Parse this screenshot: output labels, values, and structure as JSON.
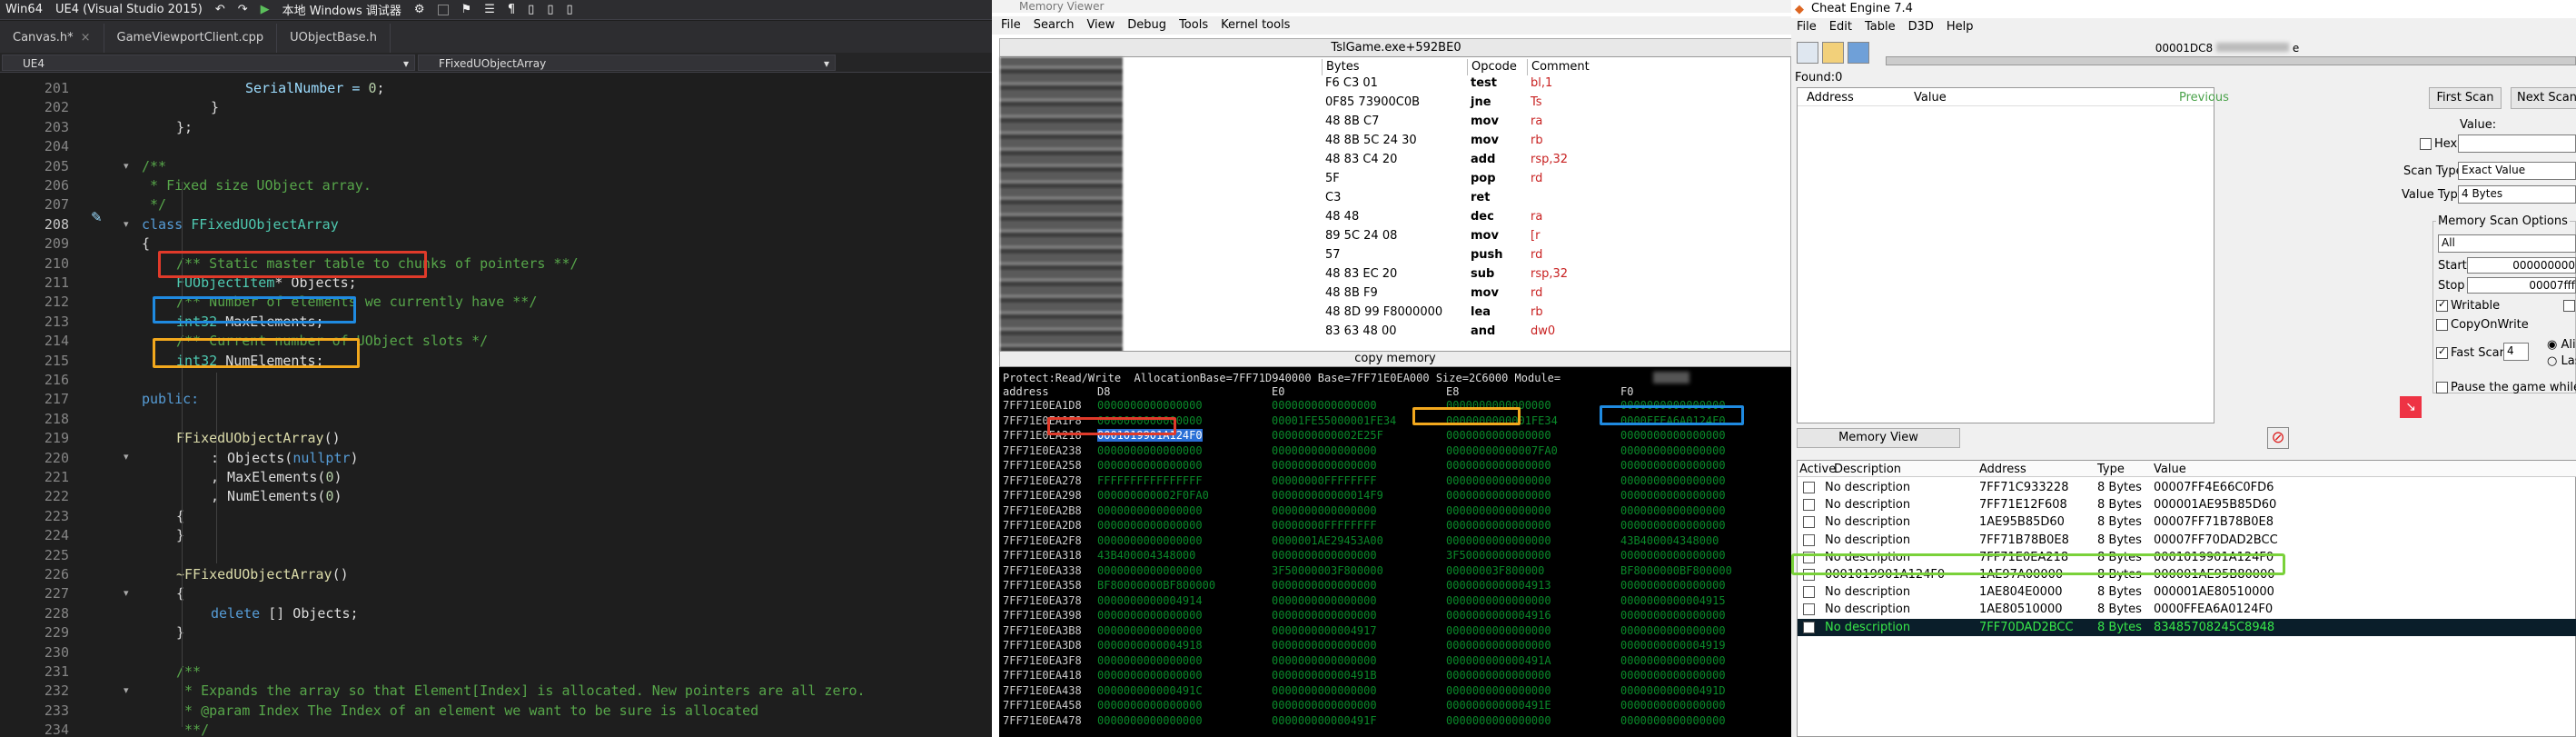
{
  "vs": {
    "config": "Win64",
    "project": "UE4 (Visual Studio 2015)",
    "debugger": "本地 Windows 调试器",
    "tabs": [
      {
        "label": "Canvas.h*"
      },
      {
        "label": "GameViewportClient.cpp"
      },
      {
        "label": "UObjectBase.h"
      }
    ],
    "nav_left": "UE4",
    "nav_right": "FFixedUObjectArray",
    "lines": [
      {
        "num": "201",
        "indent": 3,
        "parts": [
          {
            "t": "SerialNumber = ",
            "c": "var"
          },
          {
            "t": "0",
            "c": "num"
          },
          {
            "t": ";",
            "c": ""
          }
        ]
      },
      {
        "num": "202",
        "indent": 2,
        "parts": [
          {
            "t": "}",
            "c": ""
          }
        ]
      },
      {
        "num": "203",
        "indent": 1,
        "parts": [
          {
            "t": "};",
            "c": ""
          }
        ]
      },
      {
        "num": "204",
        "indent": 0,
        "parts": []
      },
      {
        "num": "205",
        "indent": 0,
        "parts": [
          {
            "t": "/**",
            "c": "com"
          }
        ]
      },
      {
        "num": "206",
        "indent": 0,
        "parts": [
          {
            "t": " * Fixed size UObject array.",
            "c": "com"
          }
        ]
      },
      {
        "num": "207",
        "indent": 0,
        "parts": [
          {
            "t": " */",
            "c": "com"
          }
        ]
      },
      {
        "num": "208",
        "indent": 0,
        "parts": [
          {
            "t": "class ",
            "c": "kw"
          },
          {
            "t": "FFixedUObjectArray",
            "c": "type"
          }
        ]
      },
      {
        "num": "209",
        "indent": 0,
        "parts": [
          {
            "t": "{",
            "c": ""
          }
        ]
      },
      {
        "num": "210",
        "indent": 1,
        "parts": [
          {
            "t": "/** Static master table to chunks of pointers **/",
            "c": "com"
          }
        ]
      },
      {
        "num": "211",
        "indent": 1,
        "parts": [
          {
            "t": "FUObjectItem",
            "c": "type"
          },
          {
            "t": "* Objects;",
            "c": ""
          }
        ]
      },
      {
        "num": "212",
        "indent": 1,
        "parts": [
          {
            "t": "/** Number of elements we currently have **/",
            "c": "com"
          }
        ]
      },
      {
        "num": "213",
        "indent": 1,
        "parts": [
          {
            "t": "int32 ",
            "c": "type"
          },
          {
            "t": "MaxElements;",
            "c": ""
          }
        ]
      },
      {
        "num": "214",
        "indent": 1,
        "parts": [
          {
            "t": "/** Current number of UObject slots */",
            "c": "com"
          }
        ]
      },
      {
        "num": "215",
        "indent": 1,
        "parts": [
          {
            "t": "int32 ",
            "c": "type"
          },
          {
            "t": "NumElements;",
            "c": ""
          }
        ]
      },
      {
        "num": "216",
        "indent": 0,
        "parts": []
      },
      {
        "num": "217",
        "indent": 0,
        "parts": [
          {
            "t": "public:",
            "c": "kw"
          }
        ]
      },
      {
        "num": "218",
        "indent": 0,
        "parts": []
      },
      {
        "num": "219",
        "indent": 1,
        "parts": [
          {
            "t": "FFixedUObjectArray",
            "c": "fn"
          },
          {
            "t": "()",
            "c": ""
          }
        ]
      },
      {
        "num": "220",
        "indent": 2,
        "parts": [
          {
            "t": ": Objects(",
            "c": ""
          },
          {
            "t": "nullptr",
            "c": "kw"
          },
          {
            "t": ")",
            "c": ""
          }
        ]
      },
      {
        "num": "221",
        "indent": 2,
        "parts": [
          {
            "t": ", MaxElements(",
            "c": ""
          },
          {
            "t": "0",
            "c": "num"
          },
          {
            "t": ")",
            "c": ""
          }
        ]
      },
      {
        "num": "222",
        "indent": 2,
        "parts": [
          {
            "t": ", NumElements(",
            "c": ""
          },
          {
            "t": "0",
            "c": "num"
          },
          {
            "t": ")",
            "c": ""
          }
        ]
      },
      {
        "num": "223",
        "indent": 1,
        "parts": [
          {
            "t": "{",
            "c": ""
          }
        ]
      },
      {
        "num": "224",
        "indent": 1,
        "parts": [
          {
            "t": "}",
            "c": ""
          }
        ]
      },
      {
        "num": "225",
        "indent": 0,
        "parts": []
      },
      {
        "num": "226",
        "indent": 1,
        "parts": [
          {
            "t": "~FFixedUObjectArray",
            "c": "fn"
          },
          {
            "t": "()",
            "c": ""
          }
        ]
      },
      {
        "num": "227",
        "indent": 1,
        "parts": [
          {
            "t": "{",
            "c": ""
          }
        ]
      },
      {
        "num": "228",
        "indent": 2,
        "parts": [
          {
            "t": "delete ",
            "c": "kw"
          },
          {
            "t": "[] Objects;",
            "c": ""
          }
        ]
      },
      {
        "num": "229",
        "indent": 1,
        "parts": [
          {
            "t": "}",
            "c": ""
          }
        ]
      },
      {
        "num": "230",
        "indent": 0,
        "parts": []
      },
      {
        "num": "231",
        "indent": 1,
        "parts": [
          {
            "t": "/**",
            "c": "com"
          }
        ]
      },
      {
        "num": "232",
        "indent": 1,
        "parts": [
          {
            "t": " * Expands the array so that Element[Index] is allocated. New pointers are all zero.",
            "c": "com"
          }
        ]
      },
      {
        "num": "233",
        "indent": 1,
        "parts": [
          {
            "t": " * @param Index The Index of an element we want to be sure is allocated",
            "c": "com"
          }
        ]
      },
      {
        "num": "234",
        "indent": 1,
        "parts": [
          {
            "t": " **/",
            "c": "com"
          }
        ]
      }
    ]
  },
  "memview": {
    "title": "Memory Viewer",
    "menu": [
      "File",
      "Search",
      "View",
      "Debug",
      "Tools",
      "Kernel tools"
    ],
    "disasm_title": "TslGame.exe+592BE0",
    "headers": [
      "Bytes",
      "Opcode",
      "Comment"
    ],
    "rows": [
      {
        "bytes": "F6 C3 01",
        "op": "test",
        "arg": "bl,1"
      },
      {
        "bytes": "0F85 73900C0B",
        "op": "jne",
        "arg": "Ts"
      },
      {
        "bytes": "48 8B C7",
        "op": "mov",
        "arg": "ra"
      },
      {
        "bytes": "48 8B 5C 24 30",
        "op": "mov",
        "arg": "rb"
      },
      {
        "bytes": "48 83 C4 20",
        "op": "add",
        "arg": "rsp,32"
      },
      {
        "bytes": "5F",
        "op": "pop",
        "arg": "rd"
      },
      {
        "bytes": "C3",
        "op": "ret",
        "arg": ""
      },
      {
        "bytes": "48 48",
        "op": "dec",
        "arg": "ra"
      },
      {
        "bytes": "89 5C 24 08",
        "op": "mov",
        "arg": "[r"
      },
      {
        "bytes": "57",
        "op": "push",
        "arg": "rd"
      },
      {
        "bytes": "48 83 EC 20",
        "op": "sub",
        "arg": "rsp,32"
      },
      {
        "bytes": "48 8B F9",
        "op": "mov",
        "arg": "rd"
      },
      {
        "bytes": "48 8D 99 F8000000",
        "op": "lea",
        "arg": "rb"
      },
      {
        "bytes": "83 63 48 00",
        "op": "and",
        "arg": "dw0"
      }
    ],
    "copy_label": "copy memory",
    "protect_line": "Protect:Read/Write  AllocationBase=7FF71D940000 Base=7FF71E0EA000 Size=2C6000 Module=",
    "col_headers": [
      "address",
      "D8",
      "E0",
      "E8",
      "F0"
    ],
    "hex_rows": [
      {
        "addr": "7FF71E0EA1D8",
        "v": [
          "0000000000000000",
          "0000000000000000",
          "0000000000000000",
          "0000000000000000"
        ]
      },
      {
        "addr": "7FF71E0EA1F8",
        "v": [
          "0000000000000000",
          "00001FE55000001FE34",
          "0000000000001FE34",
          "0000FFEA6A0124F0"
        ]
      },
      {
        "addr": "7FF71E0EA218",
        "v": [
          "0001019901A124F0",
          "0000000000002E25F",
          "0000000000000000",
          "0000000000000000"
        ]
      },
      {
        "addr": "7FF71E0EA238",
        "v": [
          "0000000000000000",
          "0000000000000000",
          "00000000000007FA0",
          "0000000000000000"
        ]
      },
      {
        "addr": "7FF71E0EA258",
        "v": [
          "0000000000000000",
          "0000000000000000",
          "0000000000000000",
          "0000000000000000"
        ]
      },
      {
        "addr": "7FF71E0EA278",
        "v": [
          "FFFFFFFFFFFFFFFF",
          "00000000FFFFFFFF",
          "0000000000000000",
          "0000000000000000"
        ]
      },
      {
        "addr": "7FF71E0EA298",
        "v": [
          "000000000002F0FA0",
          "000000000000014F9",
          "0000000000000000",
          "0000000000000000"
        ]
      },
      {
        "addr": "7FF71E0EA2B8",
        "v": [
          "0000000000000000",
          "0000000000000000",
          "0000000000000000",
          "0000000000000000"
        ]
      },
      {
        "addr": "7FF71E0EA2D8",
        "v": [
          "0000000000000000",
          "00000000FFFFFFFF",
          "0000000000000000",
          "0000000000000000"
        ]
      },
      {
        "addr": "7FF71E0EA2F8",
        "v": [
          "0000000000000000",
          "0000001AE29453A00",
          "0000000000000000",
          "43B400004348000"
        ]
      },
      {
        "addr": "7FF71E0EA318",
        "v": [
          "43B400004348000",
          "0000000000000000",
          "3F50000000000000",
          "0000000000000000"
        ]
      },
      {
        "addr": "7FF71E0EA338",
        "v": [
          "0000000000000000",
          "3F50000003F800000",
          "00000003F800000",
          "BF8000000BF800000"
        ]
      },
      {
        "addr": "7FF71E0EA358",
        "v": [
          "BF80000000BF800000",
          "0000000000000000",
          "0000000000004913",
          "0000000000000000"
        ]
      },
      {
        "addr": "7FF71E0EA378",
        "v": [
          "0000000000004914",
          "0000000000000000",
          "0000000000000000",
          "0000000000004915"
        ]
      },
      {
        "addr": "7FF71E0EA398",
        "v": [
          "0000000000000000",
          "0000000000000000",
          "0000000000004916",
          "0000000000000000"
        ]
      },
      {
        "addr": "7FF71E0EA3B8",
        "v": [
          "0000000000000000",
          "0000000000004917",
          "0000000000000000",
          "0000000000000000"
        ]
      },
      {
        "addr": "7FF71E0EA3D8",
        "v": [
          "0000000000004918",
          "0000000000000000",
          "0000000000000000",
          "0000000000004919"
        ]
      },
      {
        "addr": "7FF71E0EA3F8",
        "v": [
          "0000000000000000",
          "0000000000000000",
          "000000000000491A",
          "0000000000000000"
        ]
      },
      {
        "addr": "7FF71E0EA418",
        "v": [
          "0000000000000000",
          "000000000000491B",
          "0000000000000000",
          "0000000000000000"
        ]
      },
      {
        "addr": "7FF71E0EA438",
        "v": [
          "000000000000491C",
          "0000000000000000",
          "0000000000000000",
          "000000000000491D"
        ]
      },
      {
        "addr": "7FF71E0EA458",
        "v": [
          "0000000000000000",
          "0000000000000000",
          "000000000000491E",
          "0000000000000000"
        ]
      },
      {
        "addr": "7FF71E0EA478",
        "v": [
          "0000000000000000",
          "000000000000491F",
          "0000000000000000",
          "0000000000000000"
        ]
      }
    ]
  },
  "ce": {
    "title": "Cheat Engine 7.4",
    "menu": [
      "File",
      "Edit",
      "Table",
      "D3D",
      "Help"
    ],
    "process": "00001DC8",
    "process_suffix": "e",
    "found": "Found:0",
    "list_headers": [
      "Address",
      "Value",
      "Previous"
    ],
    "first_scan": "First Scan",
    "next_scan": "Next Scan",
    "value_label": "Value:",
    "hex_label": "Hex",
    "scan_type_label": "Scan Type",
    "scan_type": "Exact Value",
    "value_type_label": "Value Type",
    "value_type": "4 Bytes",
    "mem_opts": "Memory Scan Options",
    "mem_all": "All",
    "start_label": "Start",
    "start_val": "000000000",
    "stop_label": "Stop",
    "stop_val": "00007fff",
    "writable": "Writable",
    "copyonwrite": "CopyOnWrite",
    "fastscan": "Fast Scan",
    "fastscan_val": "4",
    "align": "Alig",
    "last": "Last",
    "pause": "Pause the game while sc",
    "memory_view": "Memory View",
    "table_headers": [
      "Active",
      "Description",
      "Address",
      "Type",
      "Value"
    ],
    "rows": [
      {
        "desc": "No description",
        "addr": "7FF71C933228",
        "type": "8 Bytes",
        "val": "00007FF4E66C0FD6"
      },
      {
        "desc": "No description",
        "addr": "7FF71E12F608",
        "type": "8 Bytes",
        "val": "000001AE95B85D60"
      },
      {
        "desc": "No description",
        "addr": "1AE95B85D60",
        "type": "8 Bytes",
        "val": "00007FF71B78B0E8"
      },
      {
        "desc": "No description",
        "addr": "7FF71B78B0E8",
        "type": "8 Bytes",
        "val": "00007FF70DAD2BCC"
      },
      {
        "desc": "No description",
        "addr": "7FF71E0EA218",
        "type": "8 Bytes",
        "val": "0001019901A124F0"
      },
      {
        "desc": "0001019901A124F0",
        "addr": "1AE97A00000",
        "type": "8 Bytes",
        "val": "000001AE95B80000"
      },
      {
        "desc": "No description",
        "addr": "1AE804E0000",
        "type": "8 Bytes",
        "val": "000001AE80510000"
      },
      {
        "desc": "No description",
        "addr": "1AE80510000",
        "type": "8 Bytes",
        "val": "0000FFEA6A0124F0"
      },
      {
        "desc": "No description",
        "addr": "7FF70DAD2BCC",
        "type": "8 Bytes",
        "val": "83485708245C8948"
      }
    ]
  }
}
